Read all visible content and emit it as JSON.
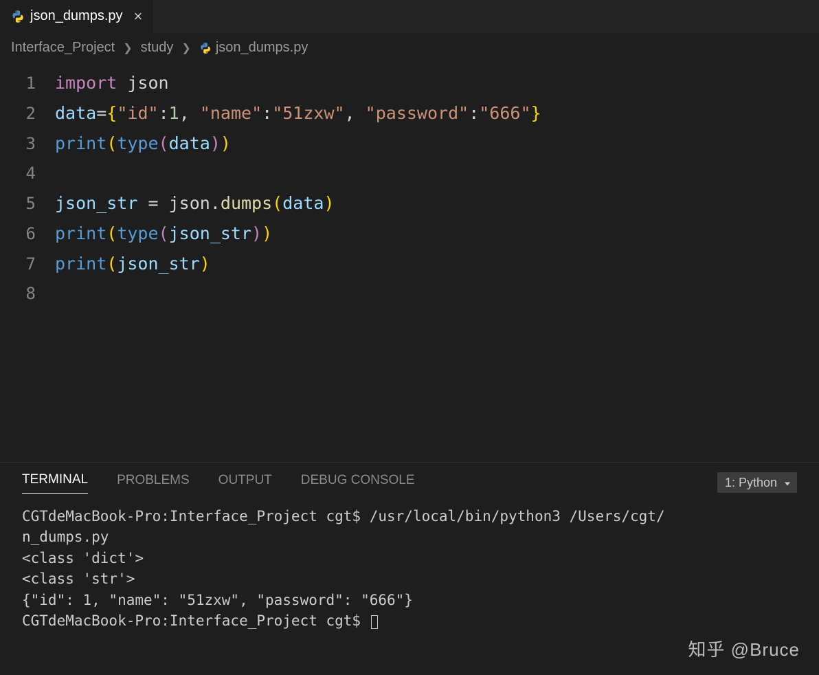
{
  "tab": {
    "filename": "json_dumps.py",
    "close_icon": "×"
  },
  "breadcrumbs": {
    "items": [
      "Interface_Project",
      "study",
      "json_dumps.py"
    ]
  },
  "code": {
    "lines": [
      {
        "n": "1"
      },
      {
        "n": "2"
      },
      {
        "n": "3"
      },
      {
        "n": "4"
      },
      {
        "n": "5"
      },
      {
        "n": "6"
      },
      {
        "n": "7"
      },
      {
        "n": "8"
      }
    ],
    "tokens": {
      "kw_import": "import",
      "mod_json": "json",
      "var_data": "data",
      "eq": "=",
      "lbrace": "{",
      "rbrace": "}",
      "s_id": "\"id\"",
      "colon": ":",
      "n_1": "1",
      "comma": ",",
      "s_name": "\"name\"",
      "s_51zxw": "\"51zxw\"",
      "s_password": "\"password\"",
      "s_666": "\"666\"",
      "fn_print": "print",
      "fn_type": "type",
      "lparen": "(",
      "rparen": ")",
      "var_json_str": "json_str",
      "mod_json2": "json",
      "dot": ".",
      "fn_dumps": "dumps"
    }
  },
  "panel": {
    "tabs": {
      "terminal": "TERMINAL",
      "problems": "PROBLEMS",
      "output": "OUTPUT",
      "debug_console": "DEBUG CONSOLE"
    },
    "terminal_selector": "1: Python"
  },
  "terminal": {
    "line1": "CGTdeMacBook-Pro:Interface_Project cgt$ /usr/local/bin/python3 /Users/cgt/",
    "line1b": "n_dumps.py",
    "line2": "<class 'dict'>",
    "line3": "<class 'str'>",
    "line4": "{\"id\": 1, \"name\": \"51zxw\", \"password\": \"666\"}",
    "line5": "CGTdeMacBook-Pro:Interface_Project cgt$ "
  },
  "watermark": "知乎 @Bruce"
}
